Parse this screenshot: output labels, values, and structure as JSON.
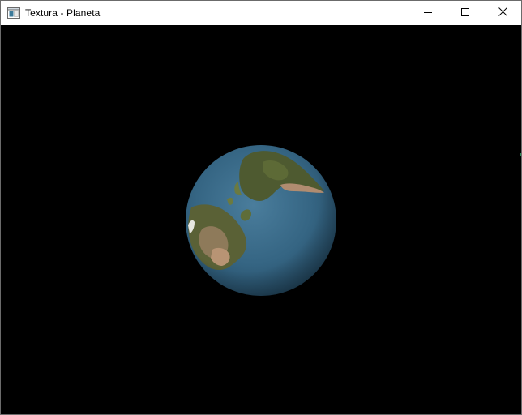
{
  "window": {
    "title": "Textura - Planeta",
    "icon": "application-window-icon"
  },
  "controls": {
    "minimize_icon": "minimize-icon",
    "maximize_icon": "maximize-icon",
    "close_icon": "close-icon"
  },
  "scene": {
    "background": "#000000",
    "object": "textured-earth-sphere",
    "ocean_color": "#3a6a8a",
    "land_color": "#4a5a2a"
  }
}
